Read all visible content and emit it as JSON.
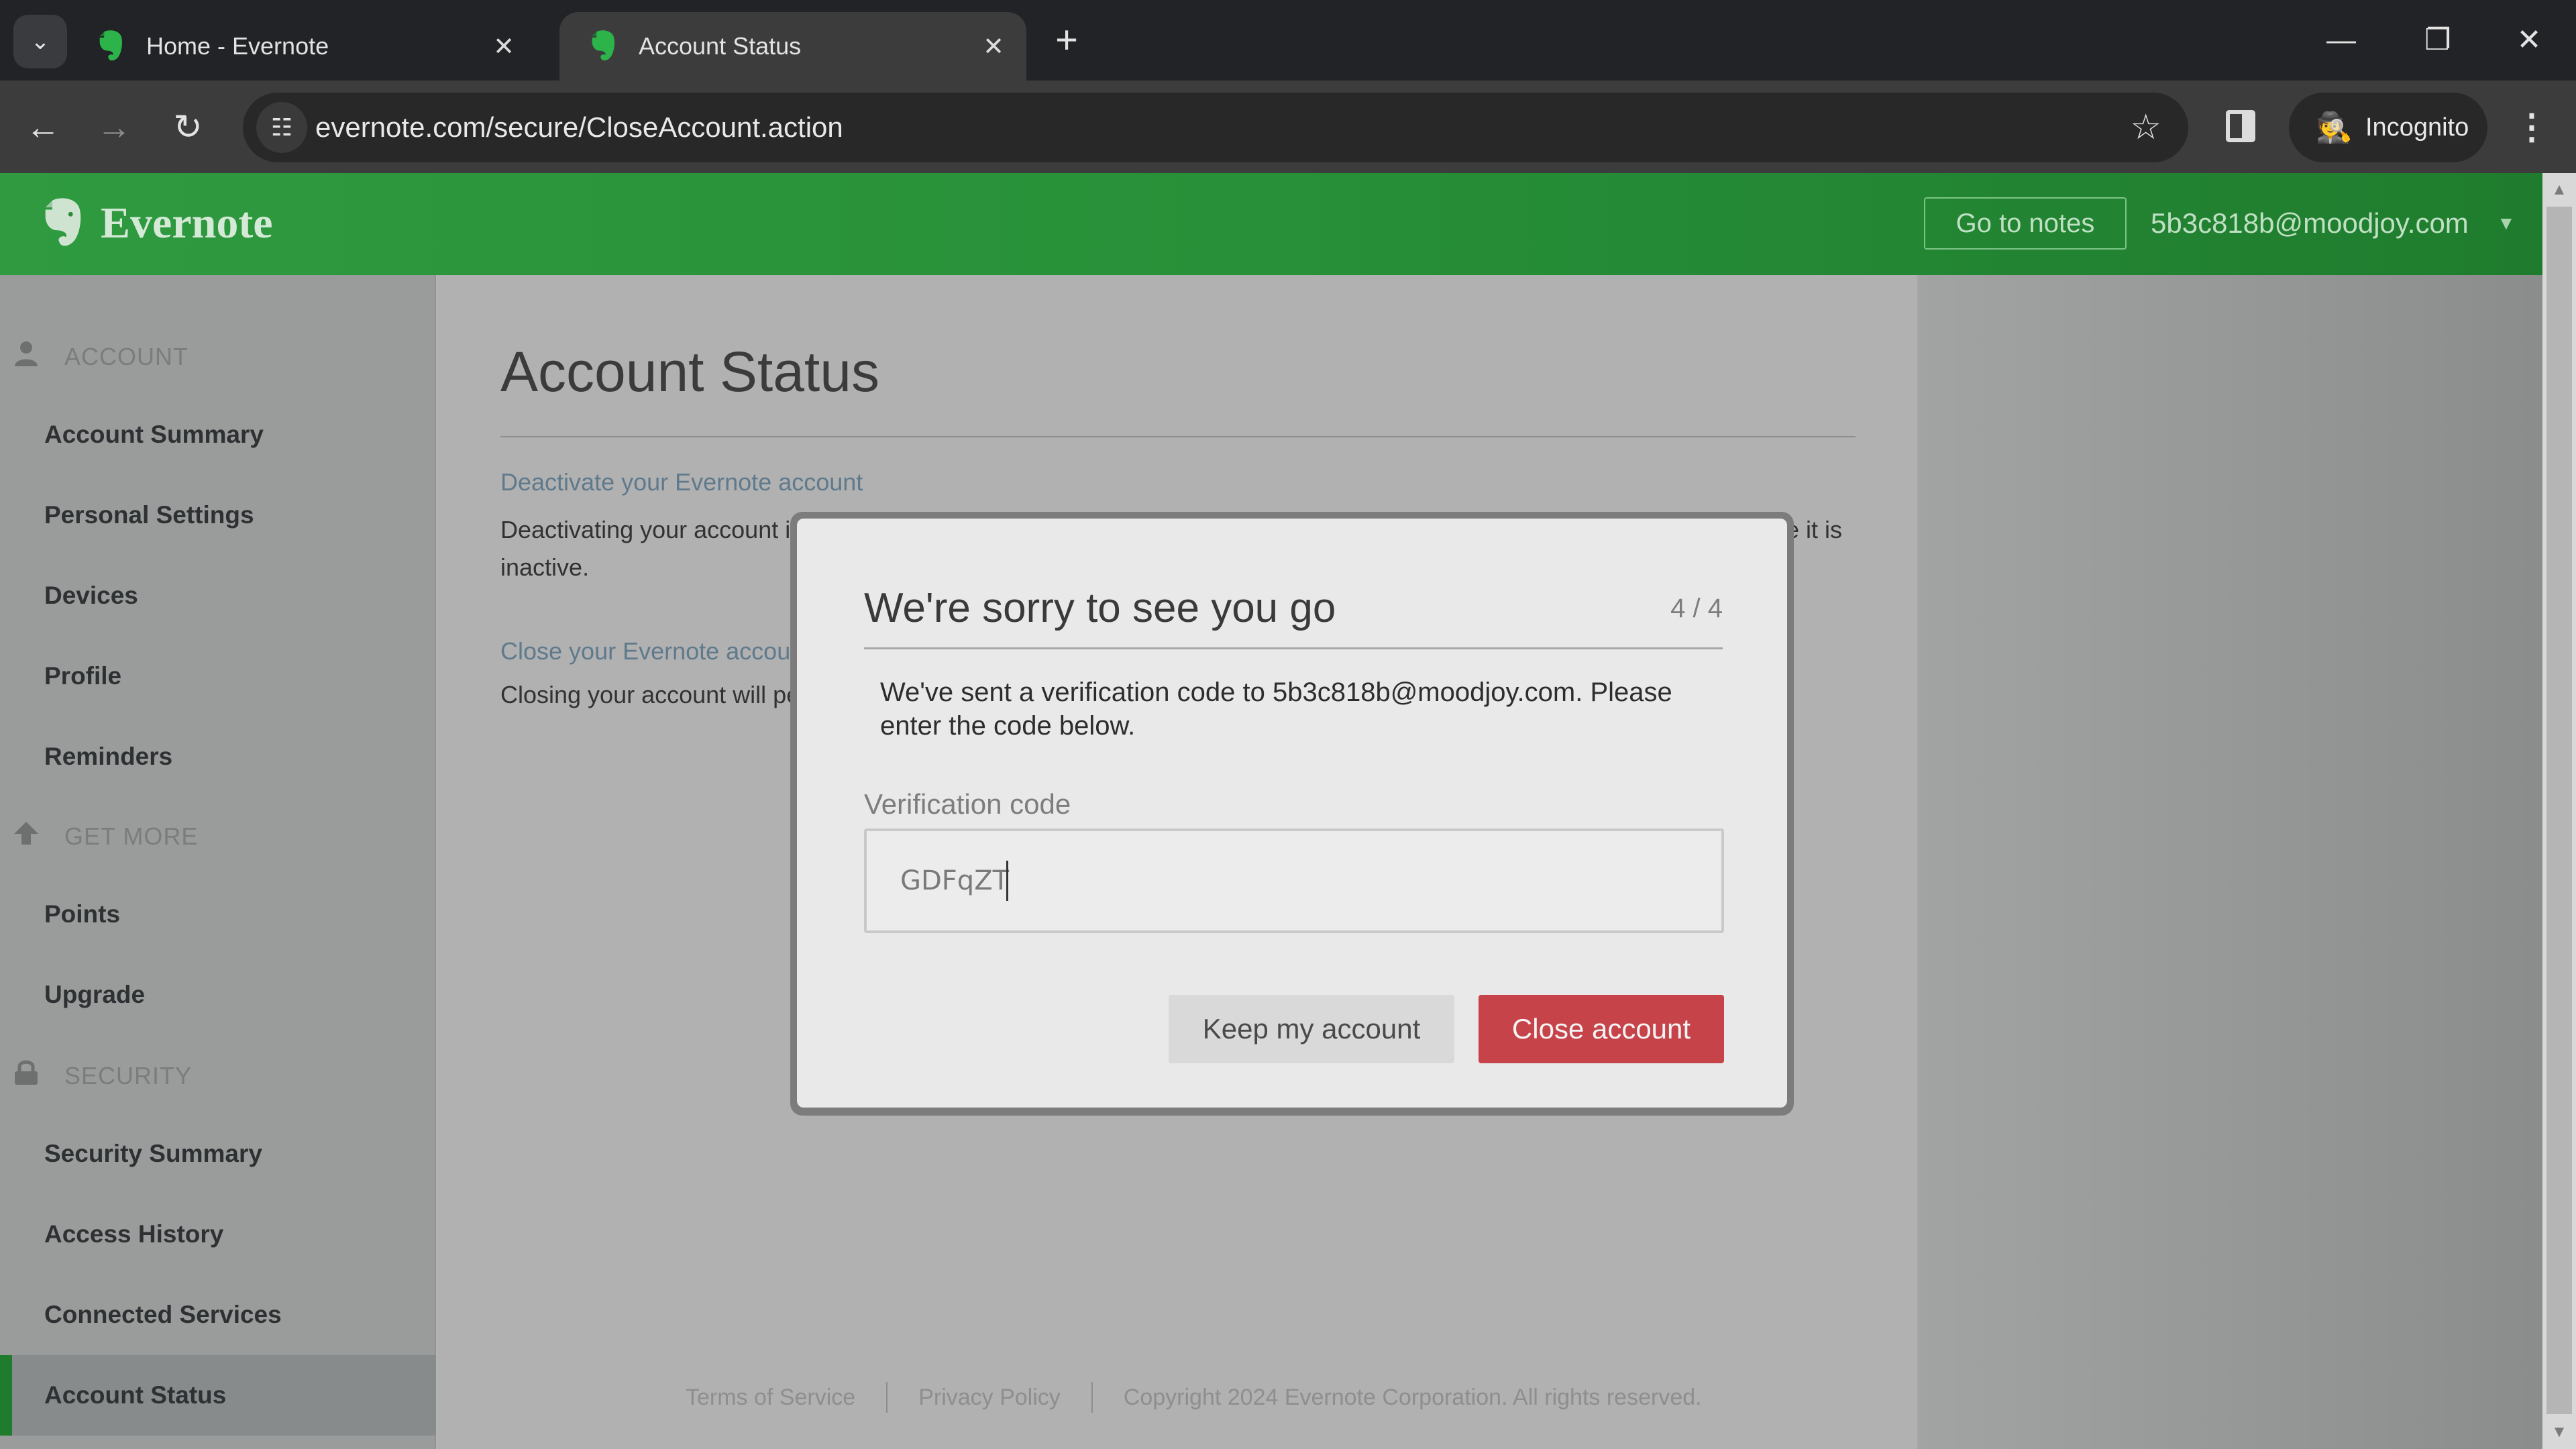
{
  "browser": {
    "tabs": [
      {
        "title": "Home - Evernote",
        "active": false
      },
      {
        "title": "Account Status",
        "active": true
      }
    ],
    "tab_close_glyph": "✕",
    "new_tab_glyph": "+",
    "tab_search_glyph": "⌄",
    "url": "evernote.com/secure/CloseAccount.action",
    "incognito_label": "Incognito",
    "window_controls": {
      "minimize": "—",
      "restore": "❐",
      "close": "✕"
    },
    "nav": {
      "back": "←",
      "forward": "→",
      "reload": "↻"
    },
    "site_info_glyph": "☷",
    "bookmark_glyph": "☆",
    "menu_glyph": "⋮",
    "incognito_glyph": "🕵"
  },
  "header": {
    "brand": "Evernote",
    "go_to_notes": "Go to notes",
    "user_email": "5b3c818b@moodjoy.com",
    "user_menu_glyph": "▼",
    "brand_color": "#2f9a3f"
  },
  "sidebar": {
    "sections": [
      {
        "label": "ACCOUNT",
        "icon": "user-icon",
        "glyph": "👤",
        "items": [
          "Account Summary",
          "Personal Settings",
          "Devices",
          "Profile",
          "Reminders"
        ]
      },
      {
        "label": "GET MORE",
        "icon": "arrow-up-icon",
        "glyph": "⬆",
        "items": [
          "Points",
          "Upgrade"
        ]
      },
      {
        "label": "SECURITY",
        "icon": "lock-icon",
        "glyph": "🔒",
        "items": [
          "Security Summary",
          "Access History",
          "Connected Services",
          "Account Status"
        ]
      }
    ],
    "active_item": "Account Status"
  },
  "main": {
    "title": "Account Status",
    "deactivate_link": "Deactivate your Evernote account",
    "deactivate_text_start": "Deactivating your account is",
    "deactivate_text_end": "e it is",
    "deactivate_text_line2": "inactive.",
    "close_link": "Close your Evernote accou",
    "close_text": "Closing your account will pe"
  },
  "footer": {
    "terms": "Terms of Service",
    "privacy": "Privacy Policy",
    "copyright": "Copyright 2024 Evernote Corporation. All rights reserved."
  },
  "modal": {
    "title": "We're sorry to see you go",
    "step": "4 / 4",
    "message": "We've sent a verification code to 5b3c818b@moodjoy.com. Please enter the code below.",
    "field_label": "Verification code",
    "field_value": "GDFqZT",
    "keep_button": "Keep my account",
    "close_button": "Close account",
    "close_button_color": "#c7434a"
  },
  "scrollbar": {
    "up": "▲",
    "down": "▼"
  }
}
